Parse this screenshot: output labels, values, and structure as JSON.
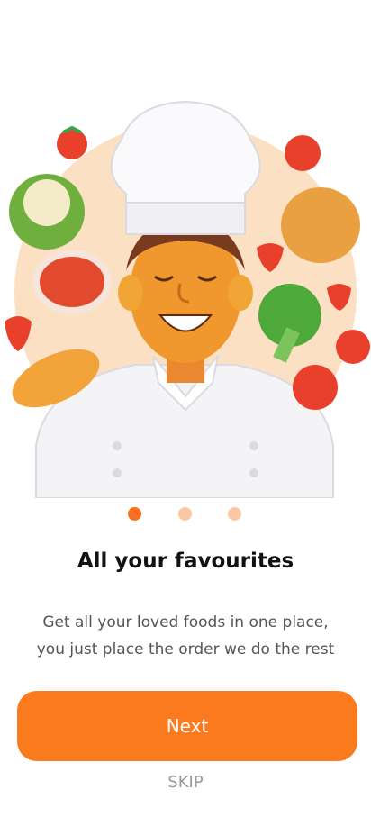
{
  "onboarding": {
    "title": "All your favourites",
    "subtitle_line1": "Get all your loved foods in one place,",
    "subtitle_line2": "you just place the order we do the rest",
    "next_label": "Next",
    "skip_label": "SKIP",
    "page_indicator": {
      "total": 3,
      "active_index": 0
    }
  },
  "colors": {
    "accent": "#FC7A1E",
    "dot_active": "#FC6E20",
    "dot_inactive": "#FAC8A3",
    "title_text": "#111111",
    "body_text": "#555555",
    "skip_text": "#9a9a9a"
  },
  "illustration": {
    "icon": "chef-with-food-illustration"
  }
}
